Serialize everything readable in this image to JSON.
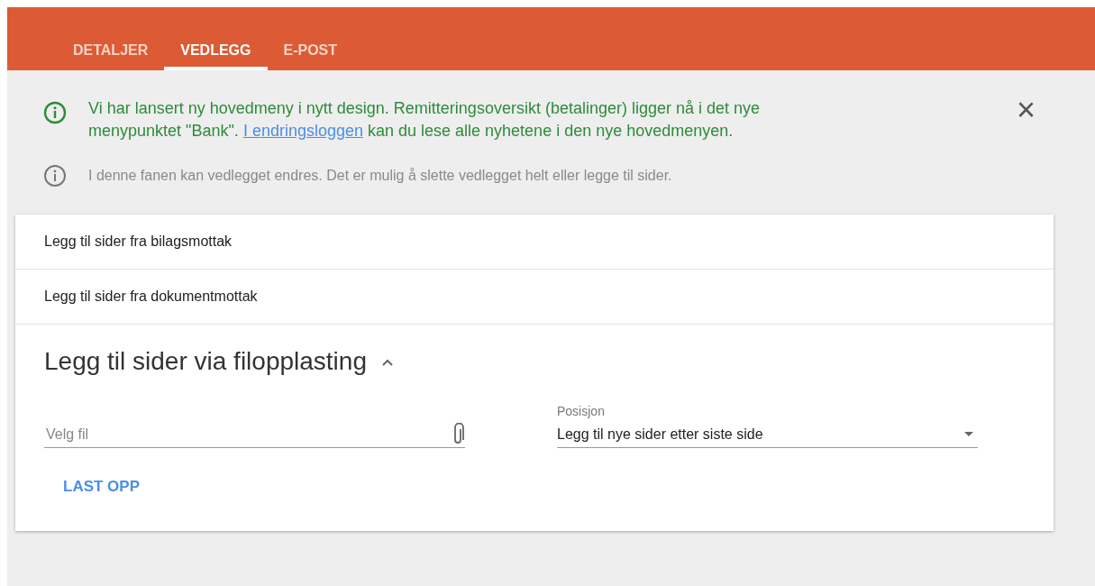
{
  "tabs": [
    {
      "label": "DETALJER",
      "selected": false
    },
    {
      "label": "VEDLEGG",
      "selected": true
    },
    {
      "label": "E-POST",
      "selected": false
    }
  ],
  "notice": {
    "text_before": "Vi har lansert ny hovedmeny i nytt design. Remitteringsoversikt (betalinger) ligger nå i det nye menypunktet \"Bank\". ",
    "link": "I endringsloggen",
    "text_after": " kan du lese alle nyhetene i den nye hovedmenyen.",
    "close": "×"
  },
  "info": "I denne fanen kan vedlegget endres. Det er mulig å slette vedlegget helt eller legge til sider.",
  "sections": [
    {
      "title": "Legg til sider fra bilagsmottak",
      "expanded": false
    },
    {
      "title": "Legg til sider fra dokumentmottak",
      "expanded": false
    },
    {
      "title": "Legg til sider via filopplasting",
      "expanded": true,
      "file_field": {
        "placeholder": "Velg fil"
      },
      "position_field": {
        "label": "Posisjon",
        "value": "Legg til nye sider etter siste side"
      },
      "button": "LAST OPP"
    }
  ]
}
